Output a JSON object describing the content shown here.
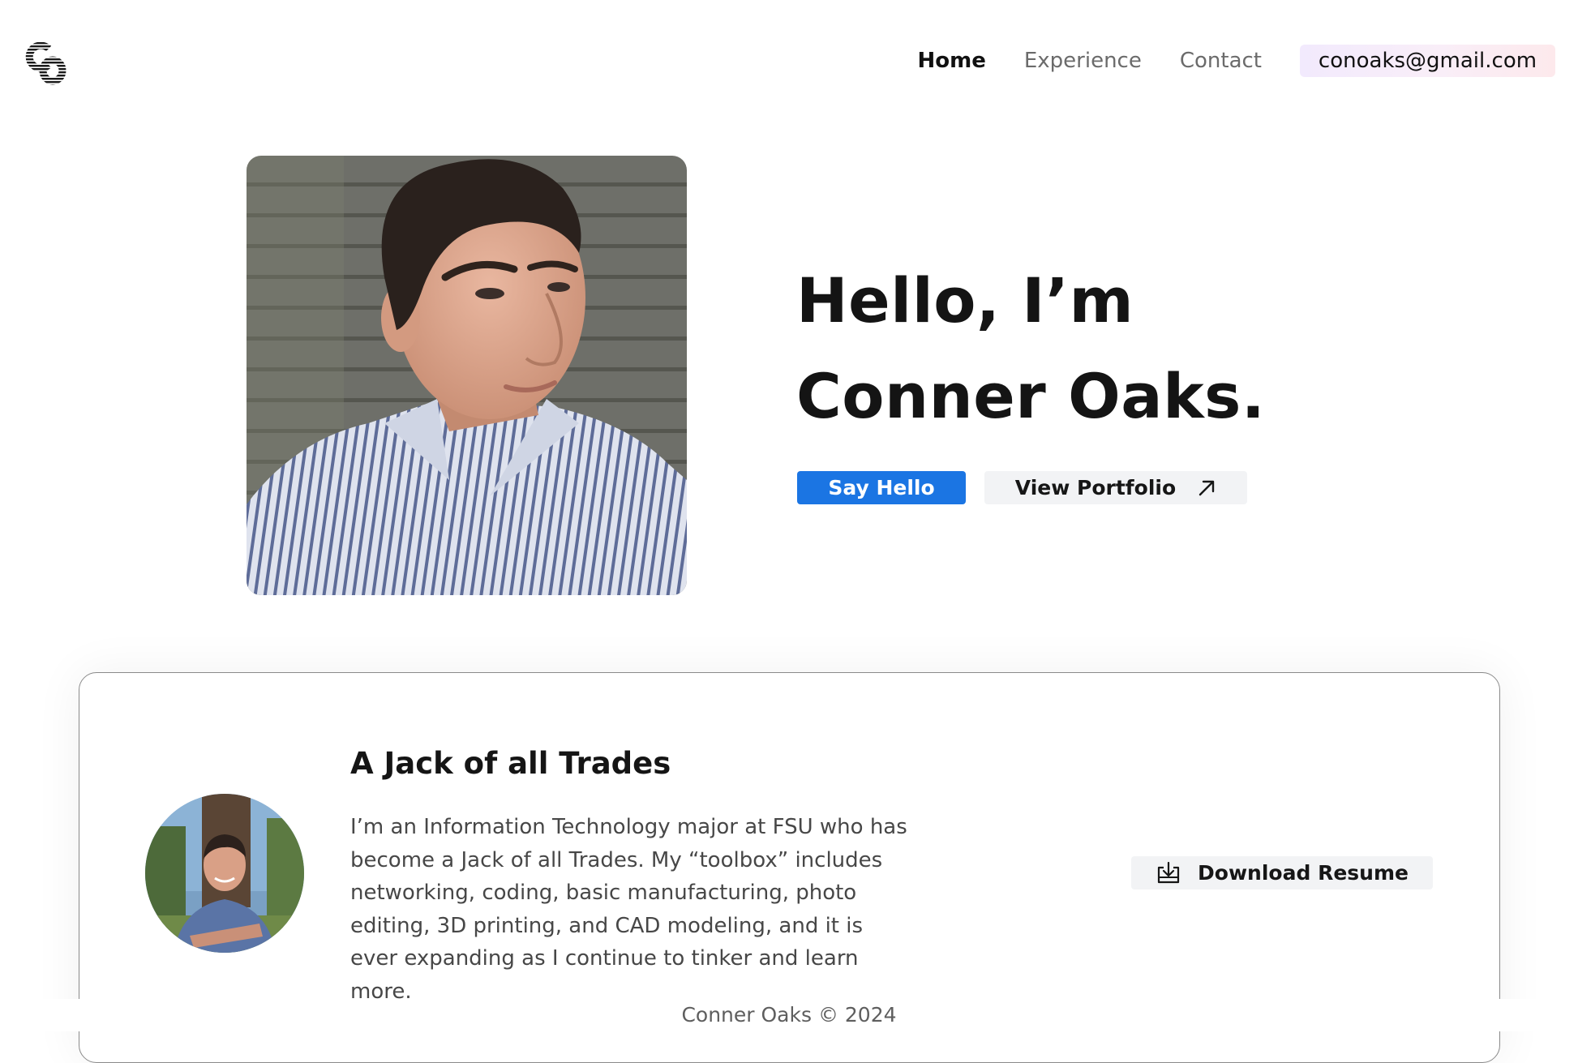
{
  "header": {
    "logo_text": "CO",
    "nav": [
      {
        "label": "Home",
        "active": true
      },
      {
        "label": "Experience",
        "active": false
      },
      {
        "label": "Contact",
        "active": false
      }
    ],
    "email": "conoaks@gmail.com"
  },
  "hero": {
    "greeting_line1": "Hello, I’m",
    "greeting_line2": "Conner Oaks.",
    "primary_button": "Say Hello",
    "secondary_button": "View Portfolio",
    "secondary_icon": "arrow-up-right-icon"
  },
  "about": {
    "title": "A Jack of all Trades",
    "text": "I’m an Information Technology major at FSU who has become a Jack of all Trades. My “toolbox” includes networking, coding, basic manufacturing, photo editing, 3D printing, and CAD modeling, and it is ever expanding as I continue to tinker and learn more.",
    "download_button": "Download Resume",
    "download_icon": "download-icon"
  },
  "footer": {
    "text": "Conner Oaks © 2024"
  },
  "colors": {
    "primary_button": "#1b75e3",
    "secondary_button": "#f2f3f5",
    "email_pill_gradient_start": "#f2eafd",
    "email_pill_gradient_end": "#fde9ec"
  }
}
